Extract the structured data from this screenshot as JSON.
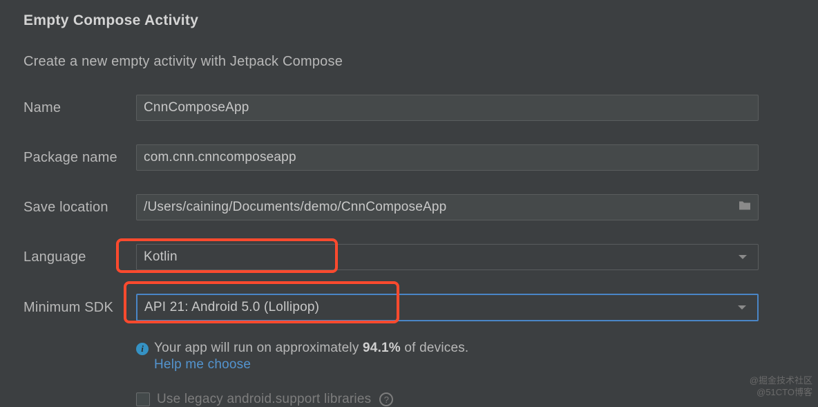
{
  "header": {
    "title": "Empty Compose Activity",
    "subtitle": "Create a new empty activity with Jetpack Compose"
  },
  "form": {
    "name": {
      "label": "Name",
      "value": "CnnComposeApp"
    },
    "package": {
      "label": "Package name",
      "value": "com.cnn.cnncomposeapp"
    },
    "save_location": {
      "label": "Save location",
      "value": "/Users/caining/Documents/demo/CnnComposeApp"
    },
    "language": {
      "label": "Language",
      "value": "Kotlin"
    },
    "min_sdk": {
      "label": "Minimum SDK",
      "value": "API 21: Android 5.0 (Lollipop)"
    }
  },
  "info": {
    "text_prefix": "Your app will run on approximately ",
    "percentage": "94.1%",
    "text_suffix": " of devices.",
    "help_link": "Help me choose"
  },
  "legacy": {
    "label": "Use legacy android.support libraries"
  },
  "watermark": {
    "line1": "@掘金技术社区",
    "line2": "@51CTO博客"
  }
}
